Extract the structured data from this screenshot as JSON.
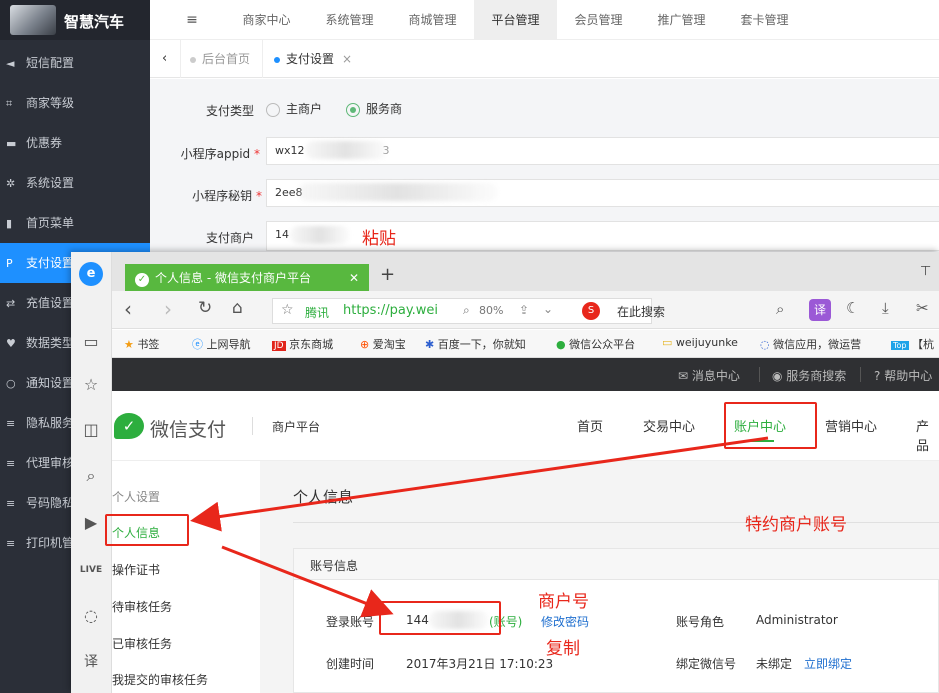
{
  "admin": {
    "logo_text": "智慧汽车",
    "sidebar": [
      {
        "label": "短信配置",
        "icon": "megaphone-icon"
      },
      {
        "label": "商家等级",
        "icon": "crop-icon"
      },
      {
        "label": "优惠券",
        "icon": "coupon-icon"
      },
      {
        "label": "系统设置",
        "icon": "gear-icon"
      },
      {
        "label": "首页菜单",
        "icon": "bookmark-icon"
      },
      {
        "label": "支付设置",
        "icon": "paypal-icon"
      },
      {
        "label": "充值设置",
        "icon": "exchange-icon"
      },
      {
        "label": "数据类型",
        "icon": "heart-icon"
      },
      {
        "label": "通知设置",
        "icon": "circle-icon"
      },
      {
        "label": "隐私服务",
        "icon": "list-icon"
      },
      {
        "label": "代理审核",
        "icon": "list-icon"
      },
      {
        "label": "号码隐私",
        "icon": "list-icon"
      },
      {
        "label": "打印机管",
        "icon": "list-icon"
      }
    ],
    "topnav": [
      "商家中心",
      "系统管理",
      "商城管理",
      "平台管理",
      "会员管理",
      "推广管理",
      "套卡管理"
    ],
    "tabs": {
      "home": "后台首页",
      "current": "支付设置",
      "close": "×"
    },
    "form": {
      "pay_type_label": "支付类型",
      "option_main": "主商户",
      "option_service": "服务商",
      "appid_label": "小程序appid",
      "appid_value": "wx12",
      "appid_tail": "3",
      "secret_label": "小程序秘钥",
      "secret_value": "2ee8",
      "merchant_label": "支付商户",
      "merchant_value": "14",
      "required_mark": "*"
    }
  },
  "browser": {
    "tab_title": "个人信息 - 微信支付商户平台",
    "tab_close": "✕",
    "new_tab": "+",
    "site_name": "腾讯",
    "url": "https://pay.wei",
    "zoom": "80%",
    "search_placeholder": "在此搜索",
    "bookmarks": [
      "书签",
      "上网导航",
      "京东商城",
      "爱淘宝",
      "百度一下，你就知",
      "微信公众平台",
      "weijuyunke",
      "微信应用，微运营",
      "【杭"
    ],
    "jd_badge": "JD",
    "top_badge": "Top",
    "translate_label": "译"
  },
  "wechat": {
    "topbar": [
      "消息中心",
      "服务商搜索",
      "帮助中心"
    ],
    "brand": "微信支付",
    "platform": "商户平台",
    "nav": [
      "首页",
      "交易中心",
      "账户中心",
      "营销中心",
      "产品"
    ],
    "left_menu_title": "个人设置",
    "left_menu": [
      "个人信息",
      "操作证书",
      "待审核任务",
      "已审核任务",
      "我提交的审核任务"
    ],
    "page_title": "个人信息",
    "card_title": "账号信息",
    "login_label": "登录账号",
    "login_value": "144",
    "login_suffix": "(账号)",
    "change_password": "修改密码",
    "role_label": "账号角色",
    "role_value": "Administrator",
    "created_label": "创建时间",
    "created_value": "2017年3月21日 17:10:23",
    "bind_label": "绑定微信号",
    "bind_value": "未绑定",
    "bind_action": "立即绑定"
  },
  "annotations": {
    "paste": "粘贴",
    "special_account": "特约商户账号",
    "merchant_no": "商户号",
    "copy": "复制",
    "color": "#e8271b"
  }
}
